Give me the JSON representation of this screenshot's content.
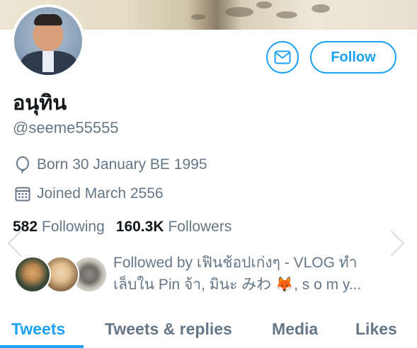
{
  "profile": {
    "display_name": "อนุทิน",
    "handle": "@seeme55555",
    "born": "Born 30 January BE 1995",
    "joined": "Joined March 2556"
  },
  "actions": {
    "follow_label": "Follow"
  },
  "stats": {
    "following_count": "582",
    "following_label": "Following",
    "followers_count": "160.3K",
    "followers_label": "Followers"
  },
  "followed_by": {
    "line1": "Followed by เฟินช้อปเก่งๆ - VLOG ทำ",
    "line2": "เล็บใน Pin จ้า, มินะ みわ 🦊, s o m y..."
  },
  "tabs": [
    {
      "label": "Tweets"
    },
    {
      "label": "Tweets & replies"
    },
    {
      "label": "Media"
    },
    {
      "label": "Likes"
    }
  ],
  "colors": {
    "accent": "#1da1f2",
    "secondary_text": "#657786",
    "primary_text": "#14171a"
  }
}
